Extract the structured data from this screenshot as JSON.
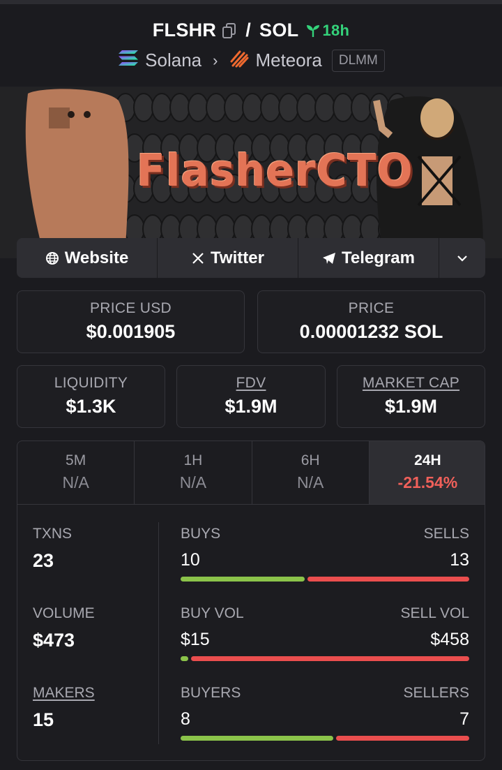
{
  "header": {
    "base_symbol": "FLSHR",
    "separator": "/",
    "quote_symbol": "SOL",
    "age": "18h",
    "chain": "Solana",
    "dex": "Meteora",
    "pool_type": "DLMM"
  },
  "banner": {
    "text": "FlasherCTO"
  },
  "links": {
    "website": "Website",
    "twitter": "Twitter",
    "telegram": "Telegram"
  },
  "stats": {
    "price_usd_label": "PRICE USD",
    "price_usd": "$0.001905",
    "price_label": "PRICE",
    "price": "0.00001232 SOL",
    "liquidity_label": "LIQUIDITY",
    "liquidity": "$1.3K",
    "fdv_label": "FDV",
    "fdv": "$1.9M",
    "mcap_label": "MARKET CAP",
    "mcap": "$1.9M"
  },
  "timeframes": [
    {
      "label": "5M",
      "value": "N/A"
    },
    {
      "label": "1H",
      "value": "N/A"
    },
    {
      "label": "6H",
      "value": "N/A"
    },
    {
      "label": "24H",
      "value": "-21.54%"
    }
  ],
  "activity": {
    "txns_label": "TXNS",
    "txns": "23",
    "buys_label": "BUYS",
    "buys": "10",
    "sells_label": "SELLS",
    "sells": "13",
    "volume_label": "VOLUME",
    "volume": "$473",
    "buy_vol_label": "BUY VOL",
    "buy_vol": "$15",
    "sell_vol_label": "SELL VOL",
    "sell_vol": "$458",
    "makers_label": "MAKERS",
    "makers": "15",
    "buyers_label": "BUYERS",
    "buyers": "8",
    "sellers_label": "SELLERS",
    "sellers": "7"
  },
  "ratios": {
    "buys_fraction": 0.435,
    "buy_vol_fraction": 0.032,
    "buyers_fraction": 0.533
  },
  "colors": {
    "buy": "#8bc34a",
    "sell": "#ea4e4e",
    "age": "#34d27a",
    "negative_change": "#f0605a"
  }
}
